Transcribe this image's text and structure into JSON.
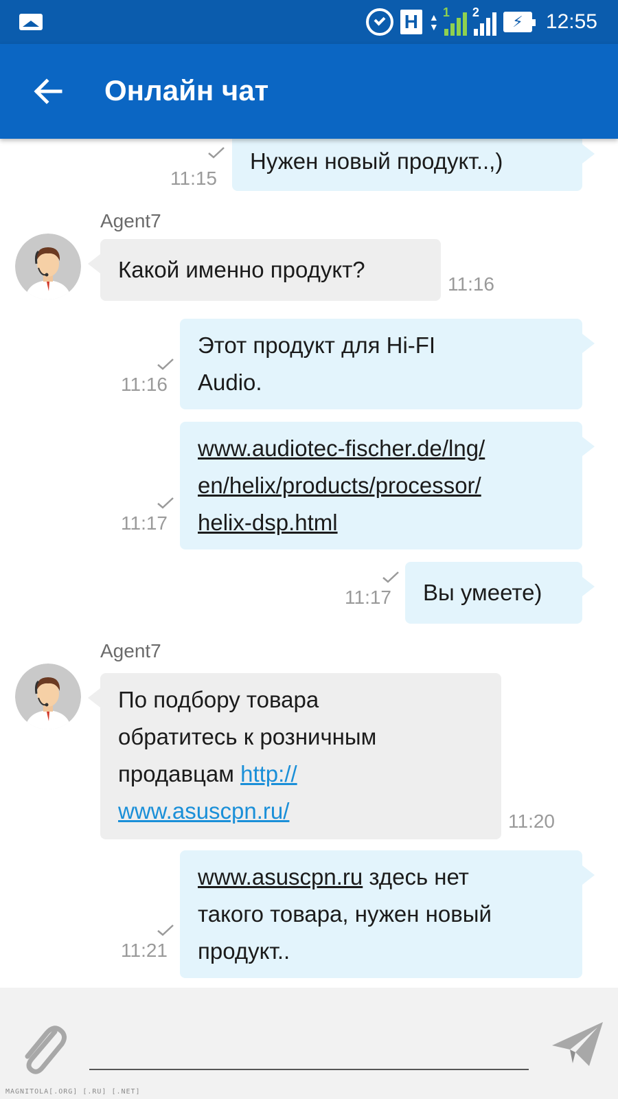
{
  "status_bar": {
    "h_indicator": "H",
    "sim1": "1",
    "sim2": "2",
    "battery_symbol": "⚡",
    "time": "12:55"
  },
  "app_bar": {
    "title": "Онлайн чат"
  },
  "messages": [
    {
      "dir": "out",
      "text": "Нужен новый продукт..,)",
      "time": "11:15",
      "read": true
    },
    {
      "dir": "in",
      "sender": "Agent7",
      "text": "Какой именно продукт?",
      "time": "11:16"
    },
    {
      "dir": "out",
      "line1": "Этот продукт для Hi-FI",
      "line2": "Audio.",
      "time": "11:16",
      "read": true
    },
    {
      "dir": "out",
      "line1": "www.audiotec-fischer.de/lng/",
      "line2": "en/helix/products/processor/",
      "line3": "helix-dsp.html",
      "time": "11:17",
      "read": true
    },
    {
      "dir": "out",
      "text": "Вы умеете)",
      "time": "11:17",
      "read": true
    },
    {
      "dir": "in",
      "sender": "Agent7",
      "line1": "По подбору товара",
      "line2": "обратитесь к розничным",
      "line3_prefix": "продавцам ",
      "line3_link": "http://",
      "line4_link": "www.asuscpn.ru/",
      "time": "11:20"
    },
    {
      "dir": "out",
      "line1_link": "www.asuscpn.ru",
      "line1_rest": " здесь нет",
      "line2": "такого товара, нужен новый",
      "line3": "продукт..",
      "time": "11:21",
      "read": true
    }
  ],
  "input": {
    "placeholder": ""
  },
  "watermark": "MAGNITOLA[.ORG] [.RU] [.NET]",
  "colors": {
    "status_bar": "#0b5cad",
    "app_bar": "#0b66c3",
    "outgoing_bubble": "#e3f4fc",
    "incoming_bubble": "#eeeeee",
    "link": "#1a8fd8",
    "input_bar": "#f2f2f2"
  },
  "icons": [
    "image-icon",
    "alarm-icon",
    "signal-sim1-icon",
    "signal-sim2-icon",
    "battery-icon",
    "back-arrow-icon",
    "read-check-icon",
    "agent-avatar",
    "paperclip-icon",
    "send-icon"
  ]
}
